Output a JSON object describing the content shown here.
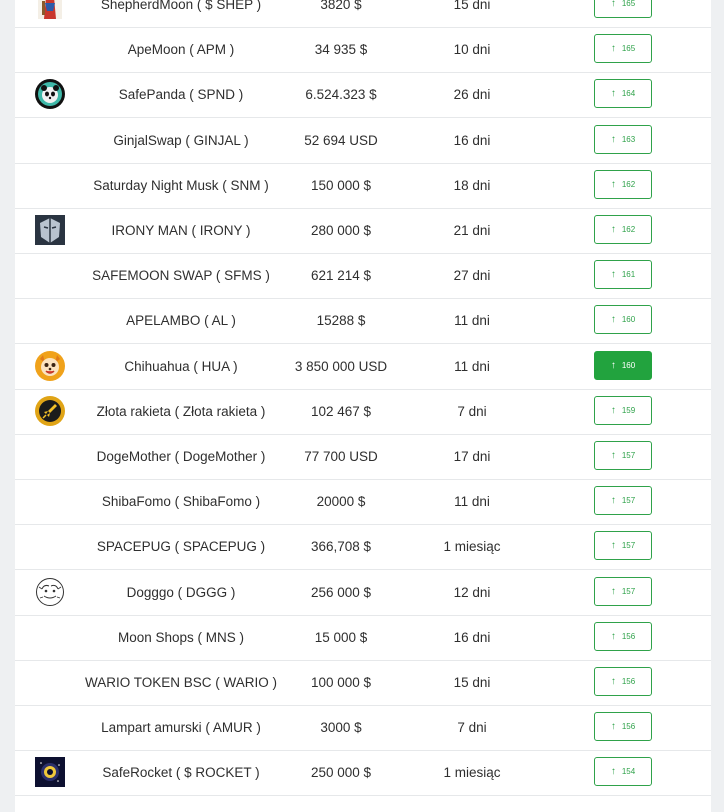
{
  "colors": {
    "accent": "#2fa24a",
    "accent_active": "#22a33e"
  },
  "vote_icon": "arrow-up-icon",
  "rows": [
    {
      "name": "ShepherdMoon ( $ SHEP )",
      "cap": "3820 $",
      "age": "15 dni",
      "votes": "165",
      "logo": "shepherdmoon-logo",
      "active": false
    },
    {
      "name": "ApeMoon ( APM )",
      "cap": "34 935 $",
      "age": "10 dni",
      "votes": "165",
      "logo": "",
      "active": false
    },
    {
      "name": "SafePanda ( SPND )",
      "cap": "6.524.323 $",
      "age": "26 dni",
      "votes": "164",
      "logo": "safepanda-logo",
      "active": false
    },
    {
      "name": "GinjalSwap ( GINJAL )",
      "cap": "52 694 USD",
      "age": "16 dni",
      "votes": "163",
      "logo": "",
      "active": false
    },
    {
      "name": "Saturday Night Musk ( SNM )",
      "cap": "150 000 $",
      "age": "18 dni",
      "votes": "162",
      "logo": "",
      "active": false
    },
    {
      "name": "IRONY MAN ( IRONY )",
      "cap": "280 000 $",
      "age": "21 dni",
      "votes": "162",
      "logo": "ironyman-logo",
      "active": false
    },
    {
      "name": "SAFEMOON SWAP ( SFMS )",
      "cap": "621 214 $",
      "age": "27 dni",
      "votes": "161",
      "logo": "",
      "active": false
    },
    {
      "name": "APELAMBO ( AL )",
      "cap": "15288 $",
      "age": "11 dni",
      "votes": "160",
      "logo": "",
      "active": false
    },
    {
      "name": "Chihuahua ( HUA )",
      "cap": "3 850 000 USD",
      "age": "11 dni",
      "votes": "160",
      "logo": "chihuahua-logo",
      "active": true
    },
    {
      "name": "Złota rakieta ( Złota rakieta )",
      "cap": "102 467 $",
      "age": "7 dni",
      "votes": "159",
      "logo": "zlota-rakieta-logo",
      "active": false
    },
    {
      "name": "DogeMother ( DogeMother )",
      "cap": "77 700 USD",
      "age": "17 dni",
      "votes": "157",
      "logo": "",
      "active": false
    },
    {
      "name": "ShibaFomo ( ShibaFomo )",
      "cap": "20000 $",
      "age": "11 dni",
      "votes": "157",
      "logo": "",
      "active": false
    },
    {
      "name": "SPACEPUG ( SPACEPUG )",
      "cap": "366,708 $",
      "age": "1 miesiąc",
      "votes": "157",
      "logo": "",
      "active": false
    },
    {
      "name": "Dogggo ( DGGG )",
      "cap": "256 000 $",
      "age": "12 dni",
      "votes": "157",
      "logo": "dogggo-logo",
      "active": false
    },
    {
      "name": "Moon Shops ( MNS )",
      "cap": "15 000 $",
      "age": "16 dni",
      "votes": "156",
      "logo": "",
      "active": false
    },
    {
      "name": "WARIO TOKEN BSC ( WARIO )",
      "cap": "100 000 $",
      "age": "15 dni",
      "votes": "156",
      "logo": "",
      "active": false
    },
    {
      "name": "Lampart amurski ( AMUR )",
      "cap": "3000 $",
      "age": "7 dni",
      "votes": "156",
      "logo": "",
      "active": false
    },
    {
      "name": "SafeRocket ( $ ROCKET )",
      "cap": "250 000 $",
      "age": "1 miesiąc",
      "votes": "154",
      "logo": "saferocket-logo",
      "active": false
    }
  ]
}
